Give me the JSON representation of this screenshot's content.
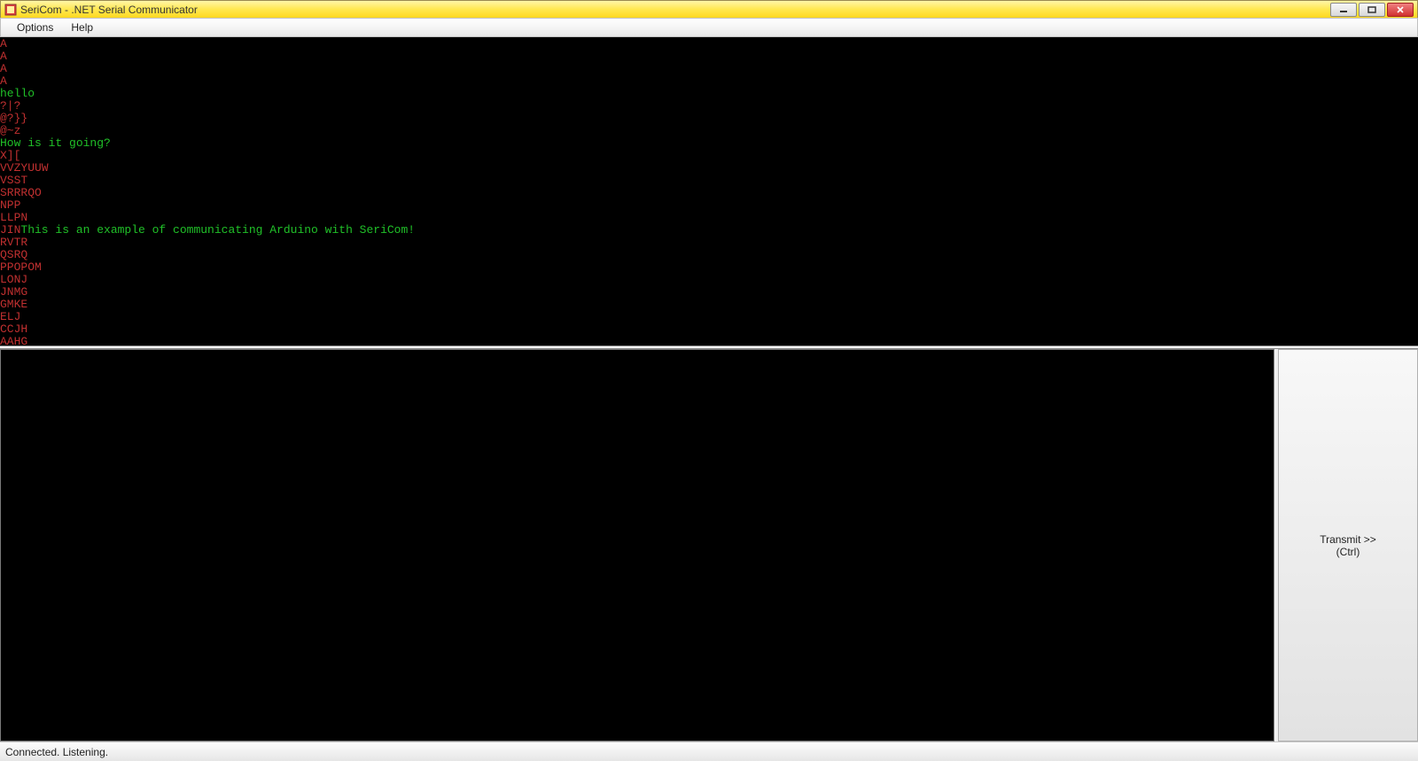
{
  "window": {
    "title": "SeriCom - .NET Serial Communicator",
    "controls": {
      "minimize": "—",
      "maximize": "❐",
      "close": "✕"
    }
  },
  "menu": {
    "options": "Options",
    "help": "Help"
  },
  "output": {
    "lines": [
      {
        "segments": [
          {
            "cls": "rx",
            "text": "A"
          }
        ]
      },
      {
        "segments": [
          {
            "cls": "rx",
            "text": "A"
          }
        ]
      },
      {
        "segments": [
          {
            "cls": "rx",
            "text": "A"
          }
        ]
      },
      {
        "segments": [
          {
            "cls": "rx",
            "text": "A"
          }
        ]
      },
      {
        "segments": [
          {
            "cls": "tx",
            "text": "hello"
          }
        ]
      },
      {
        "segments": [
          {
            "cls": "rx",
            "text": "?|?"
          }
        ]
      },
      {
        "segments": [
          {
            "cls": "rx",
            "text": "@?}}"
          }
        ]
      },
      {
        "segments": [
          {
            "cls": "rx",
            "text": "@~z"
          }
        ]
      },
      {
        "segments": [
          {
            "cls": "tx",
            "text": "How is it going?"
          }
        ]
      },
      {
        "segments": [
          {
            "cls": "rx",
            "text": "X]["
          }
        ]
      },
      {
        "segments": [
          {
            "cls": "rx",
            "text": "VVZYUUW"
          }
        ]
      },
      {
        "segments": [
          {
            "cls": "rx",
            "text": "VSST"
          }
        ]
      },
      {
        "segments": [
          {
            "cls": "rx",
            "text": "SRRRQO"
          }
        ]
      },
      {
        "segments": [
          {
            "cls": "rx",
            "text": "NPP"
          }
        ]
      },
      {
        "segments": [
          {
            "cls": "rx",
            "text": "LLPN"
          }
        ]
      },
      {
        "segments": [
          {
            "cls": "rx",
            "text": "JIN"
          },
          {
            "cls": "tx",
            "text": "This is an example of communicating Arduino with SeriCom!"
          }
        ]
      },
      {
        "segments": [
          {
            "cls": "rx",
            "text": "RVTR"
          }
        ]
      },
      {
        "segments": [
          {
            "cls": "rx",
            "text": "QSRQ"
          }
        ]
      },
      {
        "segments": [
          {
            "cls": "rx",
            "text": "PPOPOM"
          }
        ]
      },
      {
        "segments": [
          {
            "cls": "rx",
            "text": "LONJ"
          }
        ]
      },
      {
        "segments": [
          {
            "cls": "rx",
            "text": "JNMG"
          }
        ]
      },
      {
        "segments": [
          {
            "cls": "rx",
            "text": "GMKE"
          }
        ]
      },
      {
        "segments": [
          {
            "cls": "rx",
            "text": "ELJ"
          }
        ]
      },
      {
        "segments": [
          {
            "cls": "rx",
            "text": "CCJH"
          }
        ]
      },
      {
        "segments": [
          {
            "cls": "rx",
            "text": "AAHG"
          }
        ]
      }
    ]
  },
  "input": {
    "value": ""
  },
  "transmit": {
    "label_line1": "Transmit >>",
    "label_line2": "(Ctrl)"
  },
  "status": {
    "text": "Connected. Listening."
  }
}
